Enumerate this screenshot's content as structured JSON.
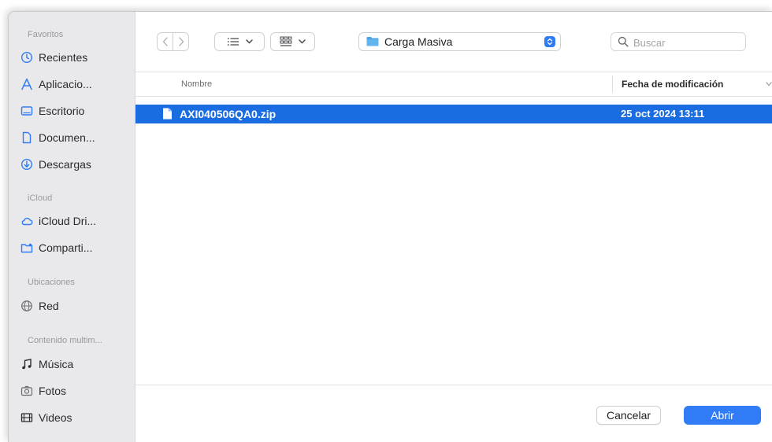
{
  "sidebar": {
    "sections": [
      {
        "label": "Favoritos",
        "items": [
          {
            "label": "Recientes",
            "icon": "clock-icon"
          },
          {
            "label": "Aplicacio...",
            "icon": "applications-icon"
          },
          {
            "label": "Escritorio",
            "icon": "desktop-icon"
          },
          {
            "label": "Documen...",
            "icon": "document-icon"
          },
          {
            "label": "Descargas",
            "icon": "download-icon"
          }
        ]
      },
      {
        "label": "iCloud",
        "items": [
          {
            "label": "iCloud Dri...",
            "icon": "cloud-icon"
          },
          {
            "label": "Comparti...",
            "icon": "shared-folder-icon"
          }
        ]
      },
      {
        "label": "Ubicaciones",
        "items": [
          {
            "label": "Red",
            "icon": "network-icon"
          }
        ]
      },
      {
        "label": "Contenido multim...",
        "items": [
          {
            "label": "Música",
            "icon": "music-icon"
          },
          {
            "label": "Fotos",
            "icon": "camera-icon"
          },
          {
            "label": "Videos",
            "icon": "film-icon"
          }
        ]
      }
    ]
  },
  "toolbar": {
    "current_folder": "Carga Masiva",
    "search_placeholder": "Buscar"
  },
  "columns": {
    "name": "Nombre",
    "modified": "Fecha de modificación"
  },
  "files": [
    {
      "name": "AXI040506QA0.zip",
      "modified": "25 oct 2024 13:11",
      "selected": true
    }
  ],
  "footer": {
    "cancel_label": "Cancelar",
    "open_label": "Abrir"
  },
  "colors": {
    "accent": "#2f7cf6",
    "selection": "#1a6de0",
    "sidebar_bg": "#e9e8ea"
  }
}
